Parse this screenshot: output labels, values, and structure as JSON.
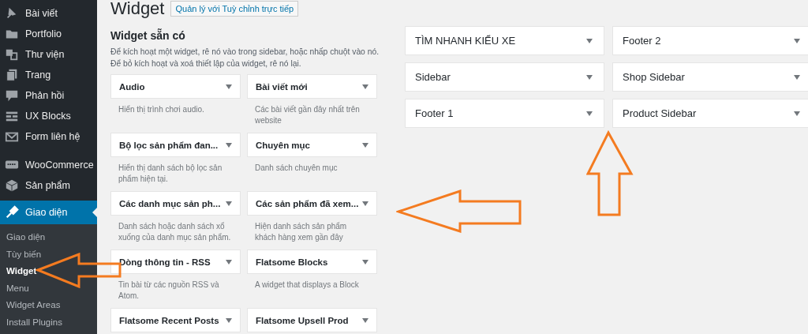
{
  "sidebar": {
    "items": [
      {
        "label": "Bài viết",
        "selected": false
      },
      {
        "label": "Portfolio",
        "selected": false
      },
      {
        "label": "Thư viện",
        "selected": false
      },
      {
        "label": "Trang",
        "selected": false
      },
      {
        "label": "Phản hồi",
        "selected": false
      },
      {
        "label": "UX Blocks",
        "selected": false
      },
      {
        "label": "Form liên hệ",
        "selected": false
      },
      {
        "label": "WooCommerce",
        "selected": false
      },
      {
        "label": "Sản phẩm",
        "selected": false
      },
      {
        "label": "Giao diện",
        "selected": true
      }
    ],
    "submenu": [
      {
        "label": "Giao diện",
        "selected": false
      },
      {
        "label": "Tùy biến",
        "selected": false
      },
      {
        "label": "Widget",
        "selected": true
      },
      {
        "label": "Menu",
        "selected": false
      },
      {
        "label": "Widget Areas",
        "selected": false
      },
      {
        "label": "Install Plugins",
        "selected": false
      }
    ]
  },
  "header": {
    "title": "Widget",
    "button": "Quản lý với Tuỳ chỉnh trực tiếp"
  },
  "available": {
    "title": "Widget sẵn có",
    "description": [
      "Để kích hoạt một widget, rê nó vào trong sidebar, hoặc nhấp chuột vào nó.",
      "Để bỏ kích hoạt và xoá thiết lập của widget, rê nó lại."
    ],
    "widgets": [
      {
        "title": "Audio",
        "description": "Hiển thị trình chơi audio."
      },
      {
        "title": "Bài viết mới",
        "description": "Các bài viết gần đây nhất trên website"
      },
      {
        "title": "Bộ lọc sản phẩm đan...",
        "description": "Hiển thị danh sách bộ lọc sản phẩm hiện tại."
      },
      {
        "title": "Chuyên mục",
        "description": "Danh sách chuyên mục"
      },
      {
        "title": "Các danh mục sản ph...",
        "description": "Danh sách hoặc danh sách xổ xuống của danh mục sản phẩm."
      },
      {
        "title": "Các sản phẩm đã xem...",
        "description": "Hiện danh sách sản phẩm khách hàng xem gần đây"
      },
      {
        "title": "Dòng thông tin - RSS",
        "description": "Tin bài từ các nguồn RSS và Atom."
      },
      {
        "title": "Flatsome Blocks",
        "description": "A widget that displays a Block"
      },
      {
        "title": "Flatsome Recent Posts"
      },
      {
        "title": "Flatsome Upsell Prod"
      }
    ]
  },
  "areas": [
    {
      "title": "TÌM NHANH KIỂU XE"
    },
    {
      "title": "Footer 2"
    },
    {
      "title": "Sidebar"
    },
    {
      "title": "Shop Sidebar"
    },
    {
      "title": "Footer 1"
    },
    {
      "title": "Product Sidebar"
    }
  ]
}
